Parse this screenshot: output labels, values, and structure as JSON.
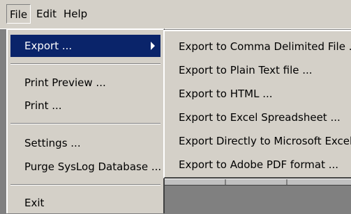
{
  "menubar": {
    "items": [
      {
        "label": "File"
      },
      {
        "label": "Edit"
      },
      {
        "label": "Help"
      }
    ]
  },
  "file_menu": {
    "items": [
      {
        "label": "Export ...",
        "selected": true,
        "has_submenu": true
      },
      {
        "label": "Print Preview ..."
      },
      {
        "label": "Print ..."
      },
      {
        "label": "Settings ..."
      },
      {
        "label": "Purge SysLog Database ..."
      },
      {
        "label": "Exit"
      }
    ]
  },
  "export_submenu": {
    "items": [
      {
        "label": "Export to Comma Delimited File ..."
      },
      {
        "label": "Export to Plain Text file ..."
      },
      {
        "label": "Export to HTML ..."
      },
      {
        "label": "Export to Excel Spreadsheet ..."
      },
      {
        "label": "Export Directly to Microsoft Excel ..."
      },
      {
        "label": "Export to Adobe PDF format ..."
      }
    ]
  },
  "colors": {
    "menu_background": "#d4d0c8",
    "selection": "#0a246a",
    "workspace": "#808080"
  },
  "icons": {
    "submenu_arrow": "triangle-right"
  }
}
